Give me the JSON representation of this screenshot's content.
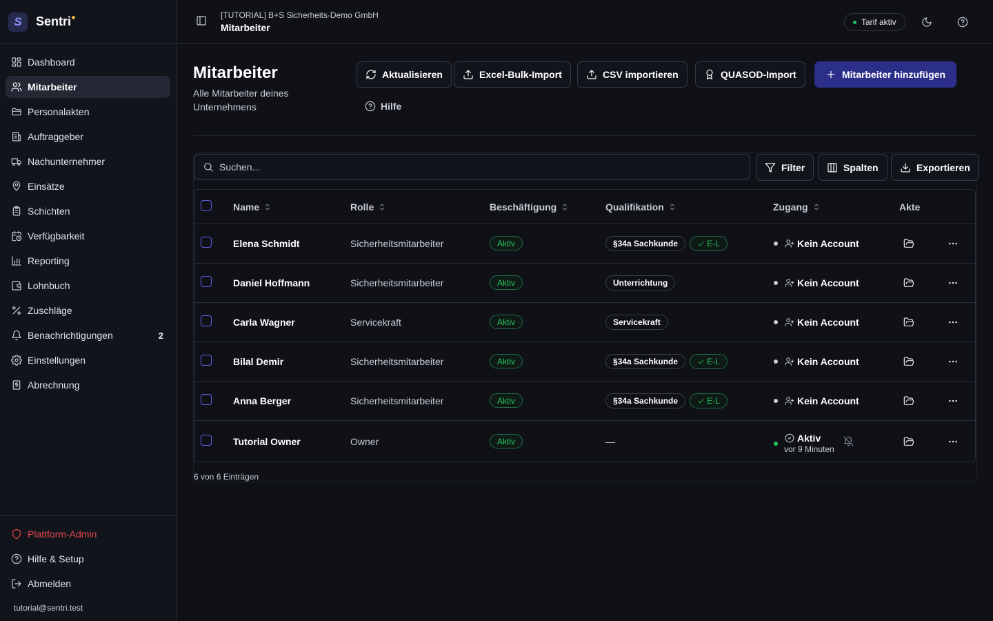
{
  "brand": {
    "logo_letter": "S",
    "name": "Sentri"
  },
  "sidebar": {
    "items": [
      {
        "label": "Dashboard",
        "icon": "dashboard-icon"
      },
      {
        "label": "Mitarbeiter",
        "icon": "users-icon",
        "active": true
      },
      {
        "label": "Personalakten",
        "icon": "folder-icon"
      },
      {
        "label": "Auftraggeber",
        "icon": "building-icon"
      },
      {
        "label": "Nachunternehmer",
        "icon": "truck-icon"
      },
      {
        "label": "Einsätze",
        "icon": "map-pin-icon"
      },
      {
        "label": "Schichten",
        "icon": "clipboard-icon"
      },
      {
        "label": "Verfügbarkeit",
        "icon": "calendar-clock-icon"
      },
      {
        "label": "Reporting",
        "icon": "bar-chart-icon"
      },
      {
        "label": "Lohnbuch",
        "icon": "wallet-icon"
      },
      {
        "label": "Zuschläge",
        "icon": "percent-icon"
      },
      {
        "label": "Benachrichtigungen",
        "icon": "bell-icon",
        "badge": "2"
      },
      {
        "label": "Einstellungen",
        "icon": "gear-icon"
      },
      {
        "label": "Abrechnung",
        "icon": "receipt-icon"
      }
    ],
    "bottom": [
      {
        "label": "Plattform-Admin",
        "icon": "shield-icon"
      },
      {
        "label": "Hilfe & Setup",
        "icon": "help-circle-icon"
      },
      {
        "label": "Abmelden",
        "icon": "logout-icon"
      }
    ],
    "user_email": "tutorial@sentri.test"
  },
  "topbar": {
    "breadcrumb_company": "[TUTORIAL] B+S Sicherheits-Demo GmbH",
    "breadcrumb_page": "Mitarbeiter",
    "plan_status": "Tarif aktiv"
  },
  "header": {
    "title": "Mitarbeiter",
    "subtitle": "Alle Mitarbeiter deines Unternehmens",
    "buttons": {
      "refresh": "Aktualisieren",
      "excel_import": "Excel-Bulk-Import",
      "csv_import": "CSV importieren",
      "quasod_import": "QUASOD-Import",
      "add": "Mitarbeiter hinzufügen"
    },
    "help": "Hilfe"
  },
  "toolbar": {
    "search_placeholder": "Suchen...",
    "filter": "Filter",
    "columns": "Spalten",
    "export": "Exportieren"
  },
  "table": {
    "columns": [
      "Name",
      "Rolle",
      "Beschäftigung",
      "Qualifikation",
      "Zugang",
      "Akte"
    ],
    "rows": [
      {
        "name": "Elena Schmidt",
        "role": "Sicherheitsmitarbeiter",
        "employment": "Aktiv",
        "qualifications": [
          "§34a Sachkunde"
        ],
        "qual_check": "E-L",
        "access": "Kein Account"
      },
      {
        "name": "Daniel Hoffmann",
        "role": "Sicherheitsmitarbeiter",
        "employment": "Aktiv",
        "qualifications": [
          "Unterrichtung"
        ],
        "qual_check": "",
        "access": "Kein Account"
      },
      {
        "name": "Carla Wagner",
        "role": "Servicekraft",
        "employment": "Aktiv",
        "qualifications": [
          "Servicekraft"
        ],
        "qual_check": "",
        "access": "Kein Account"
      },
      {
        "name": "Bilal Demir",
        "role": "Sicherheitsmitarbeiter",
        "employment": "Aktiv",
        "qualifications": [
          "§34a Sachkunde"
        ],
        "qual_check": "E-L",
        "access": "Kein Account"
      },
      {
        "name": "Anna Berger",
        "role": "Sicherheitsmitarbeiter",
        "employment": "Aktiv",
        "qualifications": [
          "§34a Sachkunde"
        ],
        "qual_check": "E-L",
        "access": "Kein Account"
      },
      {
        "name": "Tutorial Owner",
        "role": "Owner",
        "employment": "Aktiv",
        "qualifications": [],
        "qual_empty": "—",
        "access": "Aktiv",
        "access_sub": "vor 9 Minuten"
      }
    ],
    "footer": "6 von 6 Einträgen"
  },
  "colors": {
    "background": "#0f1117",
    "sidebar": "#12141c",
    "primary_button": "#2c2f8a",
    "success": "#22c55e",
    "danger": "#e5484d",
    "checkbox": "#5b63e8"
  }
}
